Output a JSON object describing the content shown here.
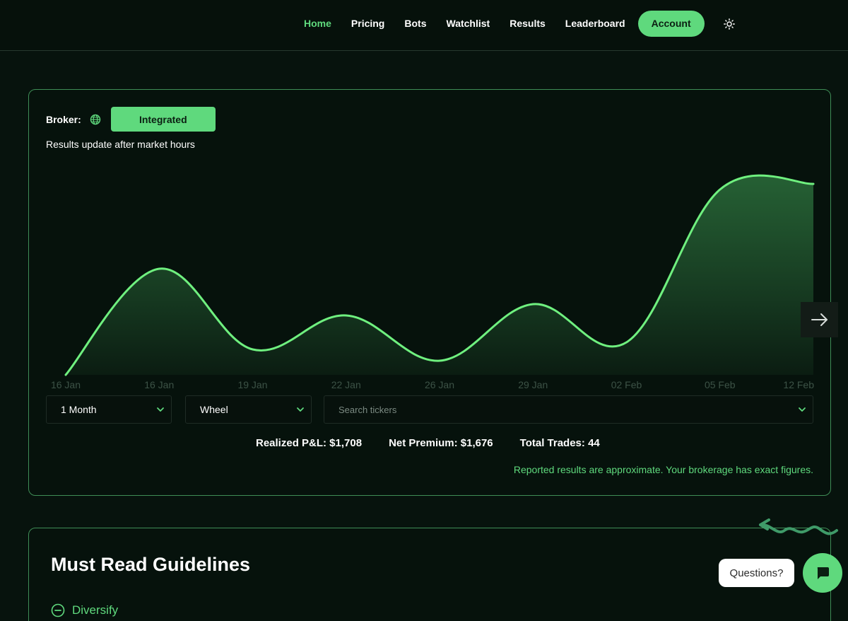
{
  "nav": {
    "items": [
      {
        "label": "Home",
        "active": true
      },
      {
        "label": "Pricing",
        "active": false
      },
      {
        "label": "Bots",
        "active": false
      },
      {
        "label": "Watchlist",
        "active": false
      },
      {
        "label": "Results",
        "active": false
      },
      {
        "label": "Leaderboard",
        "active": false
      }
    ],
    "account_label": "Account",
    "theme_icon": "sun-icon"
  },
  "results": {
    "broker_label": "Broker:",
    "broker_icon": "globe-icon",
    "broker_button": "Integrated",
    "update_note": "Results update after market hours",
    "period_select": "1 Month",
    "strategy_select": "Wheel",
    "search_placeholder": "Search tickers",
    "stats": {
      "realized_pnl": "Realized P&L: $1,708",
      "net_premium": "Net Premium: $1,676",
      "total_trades": "Total Trades: 44"
    },
    "disclaimer": "Reported results are approximate. Your brokerage has exact figures."
  },
  "chart_data": {
    "type": "area",
    "categories": [
      "16 Jan",
      "16 Jan",
      "19 Jan",
      "22 Jan",
      "26 Jan",
      "29 Jan",
      "02 Feb",
      "05 Feb",
      "12 Feb"
    ],
    "values": [
      0,
      150,
      36,
      84,
      20,
      100,
      46,
      262,
      270
    ],
    "ylim": [
      0,
      300
    ],
    "grid": false,
    "legend": "none",
    "colors": {
      "line": "#6ff07f",
      "fill_top": "#2b6e3b",
      "fill_bottom": "#0b1d12",
      "tick": "#3c5246"
    }
  },
  "guidelines": {
    "title": "Must Read Guidelines",
    "items": [
      {
        "label": "Diversify",
        "icon": "minus-circle-icon"
      }
    ]
  },
  "chat": {
    "bubble": "Questions?",
    "icon": "chat-icon"
  },
  "colors": {
    "accent": "#5fd97d",
    "background": "#07130d",
    "border": "#3f8d56"
  }
}
